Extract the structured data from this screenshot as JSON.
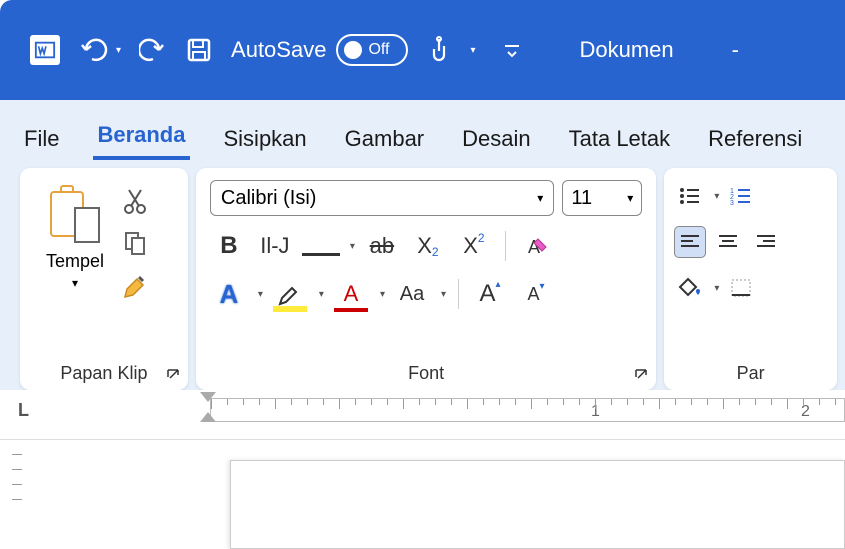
{
  "titlebar": {
    "autosave_label": "AutoSave",
    "autosave_state": "Off",
    "doc_name": "Dokumen",
    "dash": "-"
  },
  "tabs": {
    "file": "File",
    "beranda": "Beranda",
    "sisipkan": "Sisipkan",
    "gambar": "Gambar",
    "desain": "Desain",
    "tataletak": "Tata Letak",
    "referensi": "Referensi"
  },
  "clipboard": {
    "paste_label": "Tempel",
    "group_label": "Papan Klip"
  },
  "font": {
    "name": "Calibri (Isi)",
    "size": "11",
    "group_label": "Font",
    "bold": "B",
    "italic_alt": "Il-J",
    "strike": "ab",
    "sub_x": "X",
    "sub_2": "2",
    "sup_x": "X",
    "sup_2": "2",
    "effect": "A",
    "highlight": "A",
    "color": "A",
    "case": "Aa",
    "grow": "A",
    "shrink": "A"
  },
  "paragraph": {
    "group_label": "Par"
  },
  "ruler": {
    "n1": "1",
    "n2": "2"
  }
}
